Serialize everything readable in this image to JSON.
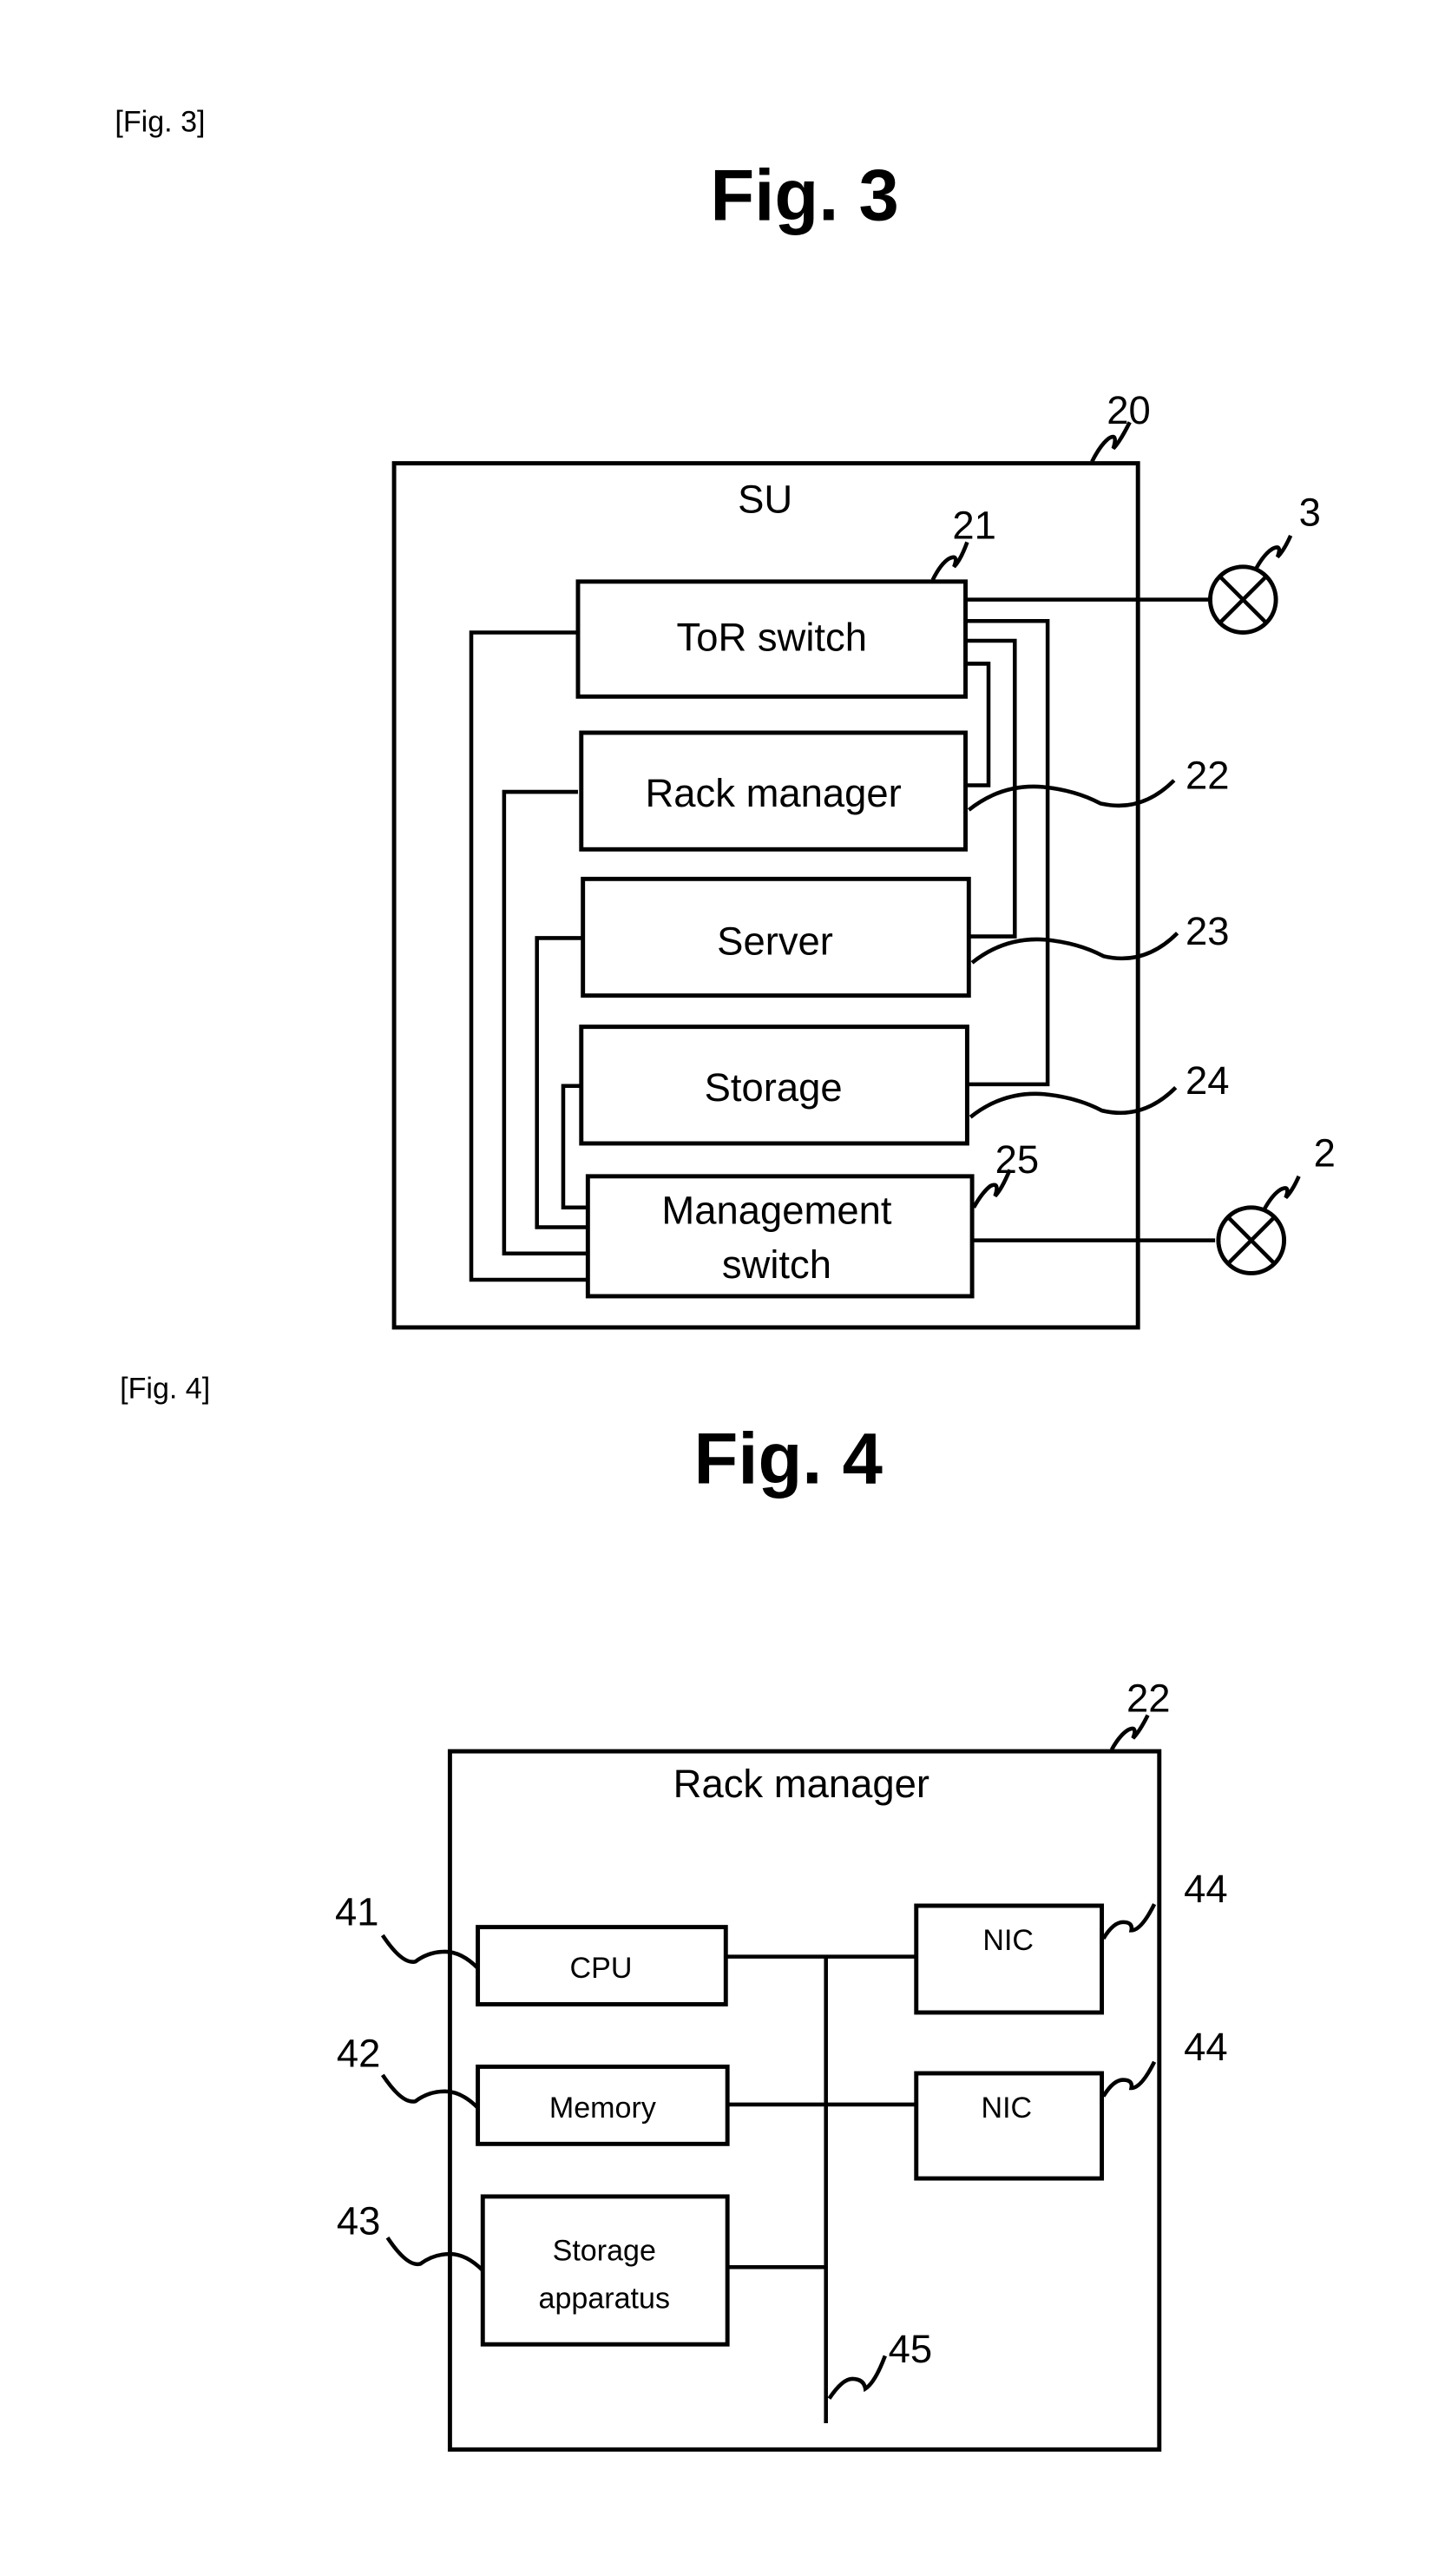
{
  "fig3": {
    "caption_tag": "[Fig. 3]",
    "title": "Fig. 3",
    "container_label": "SU",
    "container_ref": "20",
    "blocks": [
      {
        "label": "ToR switch",
        "ref": "21"
      },
      {
        "label": "Rack manager",
        "ref": "22"
      },
      {
        "label": "Server",
        "ref": "23"
      },
      {
        "label": "Storage",
        "ref": "24"
      },
      {
        "label_line1": "Management",
        "label_line2": "switch",
        "ref": "25"
      }
    ],
    "networks": [
      {
        "symbol": "network-node-x-circle",
        "ref": "3"
      },
      {
        "symbol": "network-node-x-circle",
        "ref": "2"
      }
    ]
  },
  "fig4": {
    "caption_tag": "[Fig. 4]",
    "title": "Fig. 4",
    "container_label": "Rack manager",
    "container_ref": "22",
    "blocks": [
      {
        "label": "CPU",
        "ref": "41"
      },
      {
        "label": "Memory",
        "ref": "42"
      },
      {
        "label_line1": "Storage",
        "label_line2": "apparatus",
        "ref": "43"
      },
      {
        "label": "NIC",
        "ref": "44"
      },
      {
        "label": "NIC",
        "ref": "44"
      }
    ],
    "bus_ref": "45"
  }
}
